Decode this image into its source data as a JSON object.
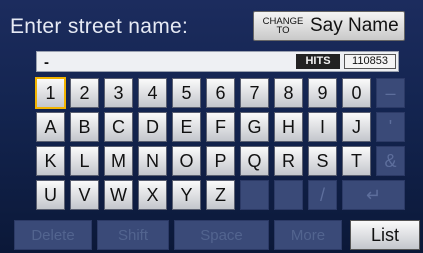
{
  "header": {
    "title": "Enter street name:",
    "change_to_top": "CHANGE",
    "change_to_bottom": "TO",
    "say_name": "Say Name"
  },
  "entry": {
    "value": "-",
    "hits_label": "HITS",
    "hits_count": "110853"
  },
  "keyboard": {
    "row1": [
      "1",
      "2",
      "3",
      "4",
      "5",
      "6",
      "7",
      "8",
      "9",
      "0",
      "–"
    ],
    "row2": [
      "A",
      "B",
      "C",
      "D",
      "E",
      "F",
      "G",
      "H",
      "I",
      "J",
      "'"
    ],
    "row3": [
      "K",
      "L",
      "M",
      "N",
      "O",
      "P",
      "Q",
      "R",
      "S",
      "T",
      "&"
    ],
    "row4": [
      "U",
      "V",
      "W",
      "X",
      "Y",
      "Z",
      "",
      "",
      "",
      "/",
      "↵"
    ],
    "selected": "1"
  },
  "bottom": {
    "delete": "Delete",
    "shift": "Shift",
    "space": "Space",
    "more": "More",
    "list": "List"
  }
}
